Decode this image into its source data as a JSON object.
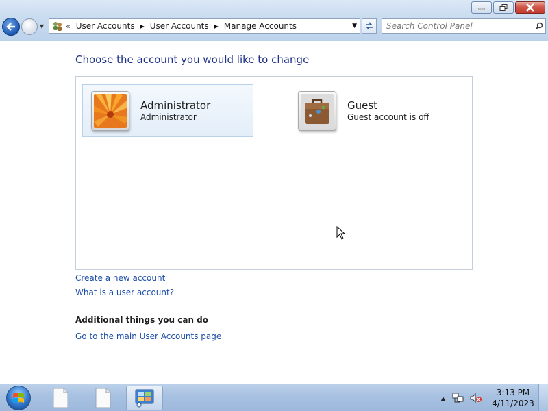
{
  "address_bar": {
    "crumbs": [
      "User Accounts",
      "User Accounts",
      "Manage Accounts"
    ]
  },
  "search": {
    "placeholder": "Search Control Panel"
  },
  "main": {
    "heading": "Choose the account you would like to change",
    "accounts": [
      {
        "name": "Administrator",
        "subtitle": "Administrator",
        "picture": "orange-flower-picture",
        "selected": true
      },
      {
        "name": "Guest",
        "subtitle": "Guest account is off",
        "picture": "briefcase-picture",
        "selected": false
      }
    ],
    "links": {
      "create_account": "Create a new account",
      "what_is_account": "What is a user account?"
    },
    "additional": {
      "heading": "Additional things you can do",
      "main_page_link": "Go to the main User Accounts page"
    }
  },
  "taskbar": {
    "buttons": [
      "document-icon",
      "document-icon",
      "control-panel-icon"
    ],
    "clock": {
      "time": "3:13 PM",
      "date": "4/11/2023"
    }
  },
  "colors": {
    "heading": "#1e3287",
    "link": "#1e4fa8",
    "selection": "#e3eef9"
  }
}
